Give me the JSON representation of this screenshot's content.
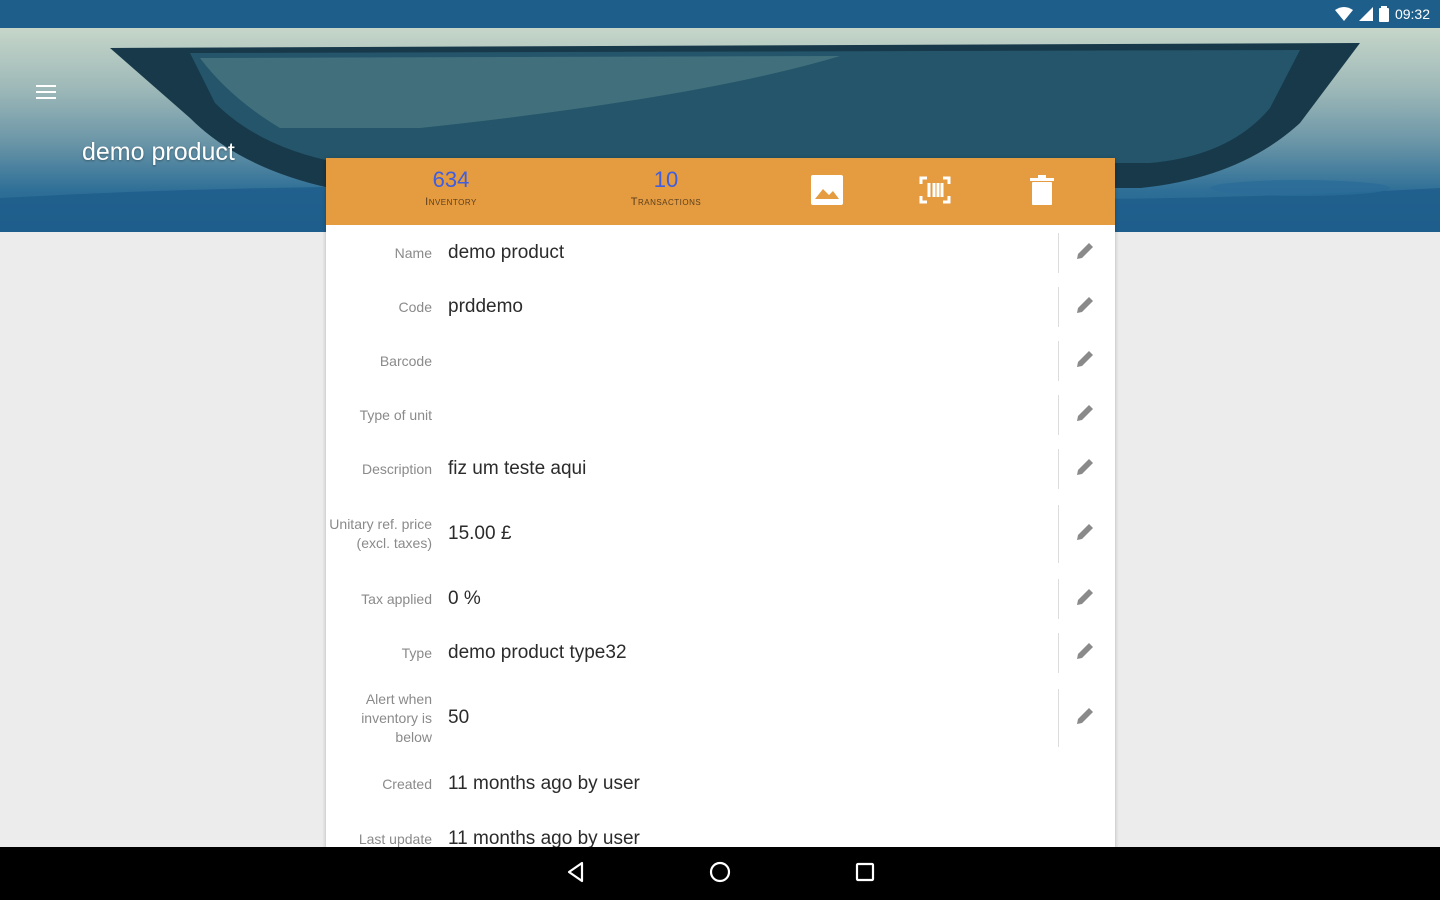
{
  "status_bar": {
    "time": "09:32",
    "icons": [
      "wifi-icon",
      "signal-icon",
      "battery-icon"
    ]
  },
  "header": {
    "title": "demo product",
    "menu_icon": "menu-icon"
  },
  "toolbar": {
    "inventory": {
      "value": "634",
      "label": "Inventory"
    },
    "transactions": {
      "value": "10",
      "label": "Transactions"
    },
    "icons": [
      "image-icon",
      "barcode-scan-icon",
      "delete-icon"
    ],
    "color": "#e59b3f"
  },
  "fields": [
    {
      "label": "Name",
      "value": "demo product",
      "editable": true
    },
    {
      "label": "Code",
      "value": "prddemo",
      "editable": true
    },
    {
      "label": "Barcode",
      "value": "",
      "editable": true
    },
    {
      "label": "Type of unit",
      "value": "",
      "editable": true
    },
    {
      "label": "Description",
      "value": "fiz um teste aqui",
      "editable": true
    },
    {
      "label": "Unitary ref. price (excl. taxes)",
      "value": "15.00 £",
      "editable": true
    },
    {
      "label": "Tax applied",
      "value": "0 %",
      "editable": true
    },
    {
      "label": "Type",
      "value": "demo product type32",
      "editable": true
    },
    {
      "label": "Alert when inventory is below",
      "value": "50",
      "editable": true
    },
    {
      "label": "Created",
      "value": "11 months ago by user",
      "editable": false
    },
    {
      "label": "Last update",
      "value": "11 months ago by user",
      "editable": false
    }
  ],
  "nav_bar": {
    "icons": [
      "back-icon",
      "home-icon",
      "recents-icon"
    ]
  },
  "colors": {
    "status_bar": "#1d5f8a",
    "accent": "#e59b3f",
    "stat_number": "#3f5ee0"
  }
}
